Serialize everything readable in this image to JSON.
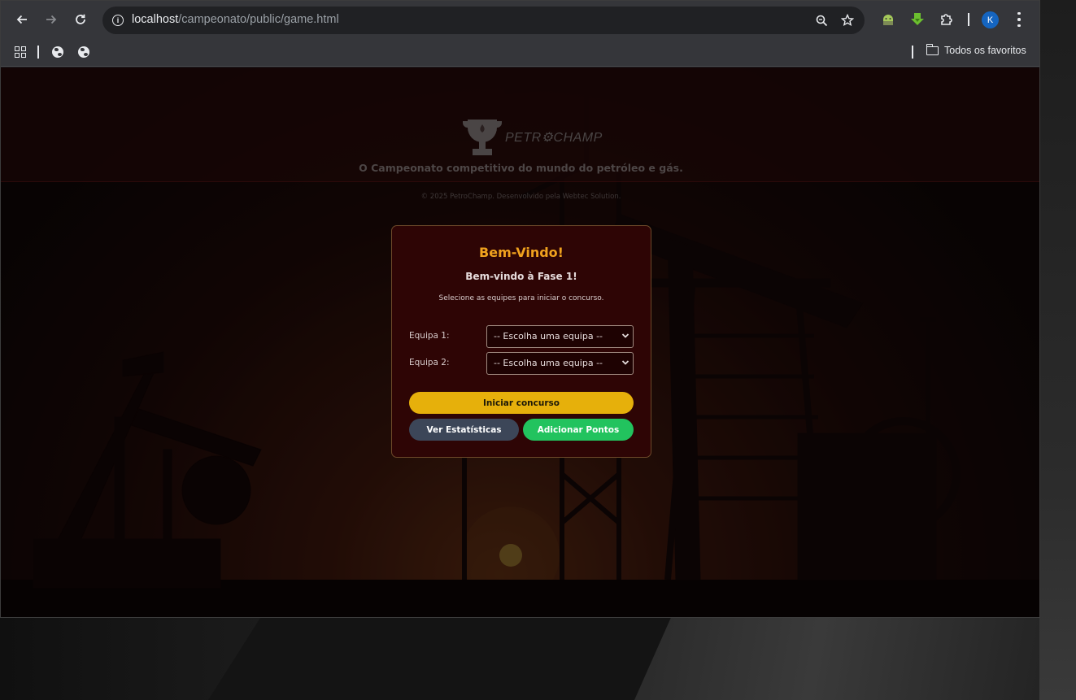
{
  "browser": {
    "url_host": "localhost",
    "url_path": "/campeonato/public/game.html",
    "profile_initial": "K",
    "bookmarks_folder": "Todos os favoritos",
    "icons": [
      "back-arrow-icon",
      "forward-arrow-icon",
      "reload-icon",
      "site-info-icon",
      "zoom-icon",
      "star-icon",
      "android-extension-icon",
      "download-extension-icon",
      "puzzle-extension-icon",
      "kebab-menu-icon",
      "apps-grid-icon",
      "globe-icon",
      "folder-icon"
    ]
  },
  "site": {
    "logo_text": "PETR⚙CHAMP",
    "tagline": "O Campeonato competitivo do mundo do petróleo e gás.",
    "copyright": "© 2025 PetroChamp. Desenvolvido pela Webtec Solution."
  },
  "modal": {
    "title": "Bem-Vindo!",
    "subtitle": "Bem-vindo à Fase 1!",
    "description": "Selecione as equipes para iniciar o concurso.",
    "team1_label": "Equipa 1:",
    "team2_label": "Equipa 2:",
    "team1_selected": "-- Escolha uma equipa --",
    "team2_selected": "-- Escolha uma equipa --",
    "start_button": "Iniciar concurso",
    "stats_button": "Ver Estatísticas",
    "add_points_button": "Adicionar Pontos"
  },
  "colors": {
    "modal_title": "#f0a21e",
    "start_button": "#e6b00b",
    "stats_button": "#3c4658",
    "add_points_button": "#22c35e",
    "modal_bg": "#2e0505"
  }
}
